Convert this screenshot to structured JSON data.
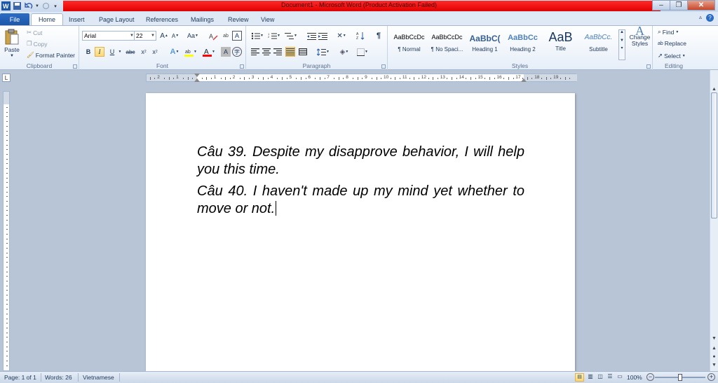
{
  "window": {
    "title": "Document1  -  Microsoft Word (Product Activation Failed)"
  },
  "qat": {
    "app_icon": "W",
    "icons": [
      "word-icon",
      "save-icon",
      "undo-icon",
      "redo-icon",
      "customize-icon"
    ]
  },
  "window_controls": {
    "minimize": "–",
    "restore": "❐",
    "close": "✕"
  },
  "tabs": [
    {
      "label": "File"
    },
    {
      "label": "Home"
    },
    {
      "label": "Insert"
    },
    {
      "label": "Page Layout"
    },
    {
      "label": "References"
    },
    {
      "label": "Mailings"
    },
    {
      "label": "Review"
    },
    {
      "label": "View"
    }
  ],
  "ribbon": {
    "clipboard": {
      "label": "Clipboard",
      "paste": "Paste",
      "cut": "Cut",
      "copy": "Copy",
      "format_painter": "Format Painter"
    },
    "font": {
      "label": "Font",
      "font_name": "Arial",
      "font_size": "22",
      "grow": "A",
      "shrink": "A",
      "change_case": "Aa",
      "bold": "B",
      "italic": "I",
      "underline": "U",
      "strikethrough": "abc",
      "subscript": "x",
      "superscript": "x",
      "highlight_color": "#ffff00",
      "font_color": "#ff0000"
    },
    "paragraph": {
      "label": "Paragraph",
      "pilcrow": "¶"
    },
    "styles": {
      "label": "Styles",
      "items": [
        {
          "sample": "AaBbCcDc",
          "name": "¶ Normal"
        },
        {
          "sample": "AaBbCcDc",
          "name": "¶ No Spaci..."
        },
        {
          "sample": "AaBbC(",
          "name": "Heading 1"
        },
        {
          "sample": "AaBbCc",
          "name": "Heading 2"
        },
        {
          "sample": "AaB",
          "name": "Title"
        },
        {
          "sample": "AaBbCc.",
          "name": "Subtitle"
        }
      ],
      "change_styles": "Change Styles"
    },
    "editing": {
      "label": "Editing",
      "find": "Find",
      "replace": "Replace",
      "select": "Select"
    }
  },
  "ruler": {
    "numbers": [
      "2",
      "1",
      "1",
      "2",
      "3",
      "4",
      "5",
      "6",
      "7",
      "8",
      "9",
      "10",
      "11",
      "12",
      "13",
      "14",
      "15",
      "16",
      "17",
      "18",
      "19"
    ]
  },
  "document": {
    "paragraphs": [
      "Câu 39. Despite my disapprove behavior, I will help you this time.",
      "Câu 40. I haven't made up my mind yet whether to move or not."
    ]
  },
  "statusbar": {
    "page": "Page: 1 of 1",
    "words": "Words: 26",
    "language": "Vietnamese",
    "zoom": "100%",
    "zoom_level": 1.0
  }
}
